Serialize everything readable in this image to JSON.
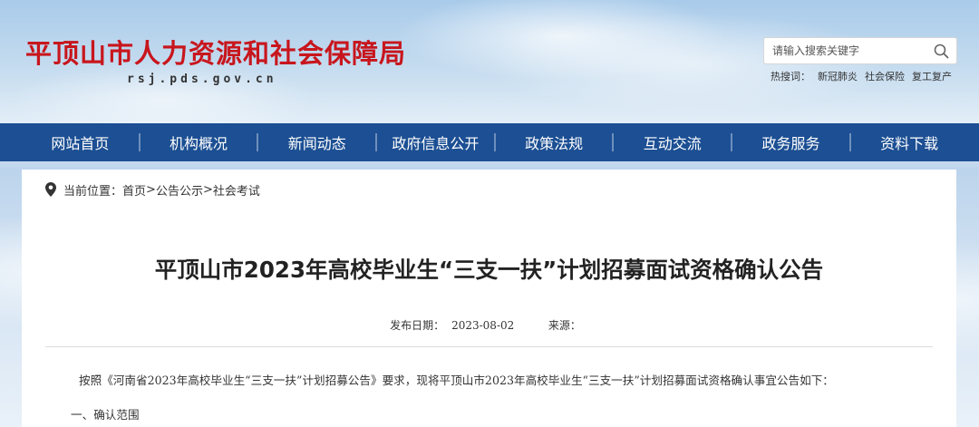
{
  "header": {
    "site_title": "平顶山市人力资源和社会保障局",
    "site_domain": "rsj.pds.gov.cn",
    "title_color": "#c8161d"
  },
  "search": {
    "placeholder": "请输入搜索关键字",
    "icon": "search-icon",
    "hot_label": "热搜词：",
    "hot_words": [
      "新冠肺炎",
      "社会保险",
      "复工复产"
    ]
  },
  "nav": {
    "background": "#1c4f93",
    "items": [
      "网站首页",
      "机构概况",
      "新闻动态",
      "政府信息公开",
      "政策法规",
      "互动交流",
      "政务服务",
      "资料下载"
    ]
  },
  "breadcrumb": {
    "icon": "location-pin-icon",
    "prefix": "当前位置：",
    "items": [
      "首页",
      "公告公示",
      "社会考试"
    ],
    "separator": ">"
  },
  "article": {
    "title": "平顶山市2023年高校毕业生“三支一扶”计划招募面试资格确认公告",
    "publish_label": "发布日期：",
    "publish_date": "2023-08-02",
    "source_label": "来源：",
    "source_value": "",
    "paragraph1": "按照《河南省2023年高校毕业生“三支一扶”计划招募公告》要求，现将平顶山市2023年高校毕业生“三支一扶”计划招募面试资格确认事宜公告如下：",
    "section1_heading": "一、确认范围"
  }
}
